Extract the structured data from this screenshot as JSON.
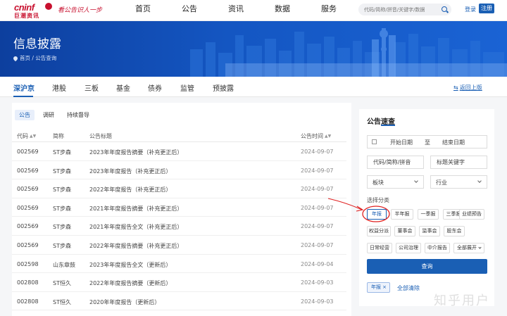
{
  "brand": {
    "logo_text": "cninf",
    "logo_sub": "巨潮资讯",
    "slogan": "看公告识人一步"
  },
  "nav": [
    "首页",
    "公告",
    "资讯",
    "数据",
    "服务"
  ],
  "search": {
    "placeholder": "代码/简称/拼音/关键字/数据"
  },
  "auth": {
    "login": "登录",
    "register": "注册"
  },
  "banner": {
    "title": "信息披露",
    "breadcrumb": "首页 / 公告查询"
  },
  "market_tabs": [
    "深沪京",
    "港股",
    "三板",
    "基金",
    "债券",
    "监管",
    "预披露"
  ],
  "back_link": "返回上版",
  "sub_tabs": [
    "公告",
    "调研",
    "持续督导"
  ],
  "table": {
    "headers": {
      "code": "代码",
      "name": "简称",
      "title": "公告标题",
      "time": "公告时间"
    },
    "rows": [
      {
        "code": "002569",
        "name": "ST步森",
        "title": "2023年年度报告摘要（补充更正后）",
        "time": "2024-09-07"
      },
      {
        "code": "002569",
        "name": "ST步森",
        "title": "2023年年度报告（补充更正后）",
        "time": "2024-09-07"
      },
      {
        "code": "002569",
        "name": "ST步森",
        "title": "2022年年度报告（补充更正后）",
        "time": "2024-09-07"
      },
      {
        "code": "002569",
        "name": "ST步森",
        "title": "2021年年度报告摘要（补充更正后）",
        "time": "2024-09-07"
      },
      {
        "code": "002569",
        "name": "ST步森",
        "title": "2021年年度报告全文（补充更正后）",
        "time": "2024-09-07"
      },
      {
        "code": "002569",
        "name": "ST步森",
        "title": "2022年年度报告摘要（补充更正后）",
        "time": "2024-09-07"
      },
      {
        "code": "002598",
        "name": "山东章鼓",
        "title": "2023年年度报告全文（更新后）",
        "time": "2024-09-04"
      },
      {
        "code": "002808",
        "name": "ST恒久",
        "title": "2022年年度报告摘要（更新后）",
        "time": "2024-09-03"
      },
      {
        "code": "002808",
        "name": "ST恒久",
        "title": "2020年年度报告（更新后）",
        "time": "2024-09-03"
      }
    ]
  },
  "filter": {
    "title": "公告速查",
    "start_date": "开始日期",
    "date_sep": "至",
    "end_date": "结束日期",
    "code_placeholder": "代码/简称/拼音",
    "keyword_placeholder": "标题关键字",
    "plate": "板块",
    "industry": "行业",
    "category_label": "选择分类",
    "categories": [
      "年报",
      "半年报",
      "一季报",
      "三季报",
      "业绩预告",
      "权益分派",
      "董事会",
      "监事会",
      "股东会",
      "日常经营",
      "公司治理",
      "中介报告",
      "全部展开"
    ],
    "query_button": "查询",
    "selected_tag": "年报",
    "tag_close": "×",
    "clear_all": "全部清除"
  },
  "watermark": "知乎用户",
  "colors": {
    "accent": "#1a5fb4",
    "brand": "#c8102e",
    "annotation": "#e02020"
  }
}
